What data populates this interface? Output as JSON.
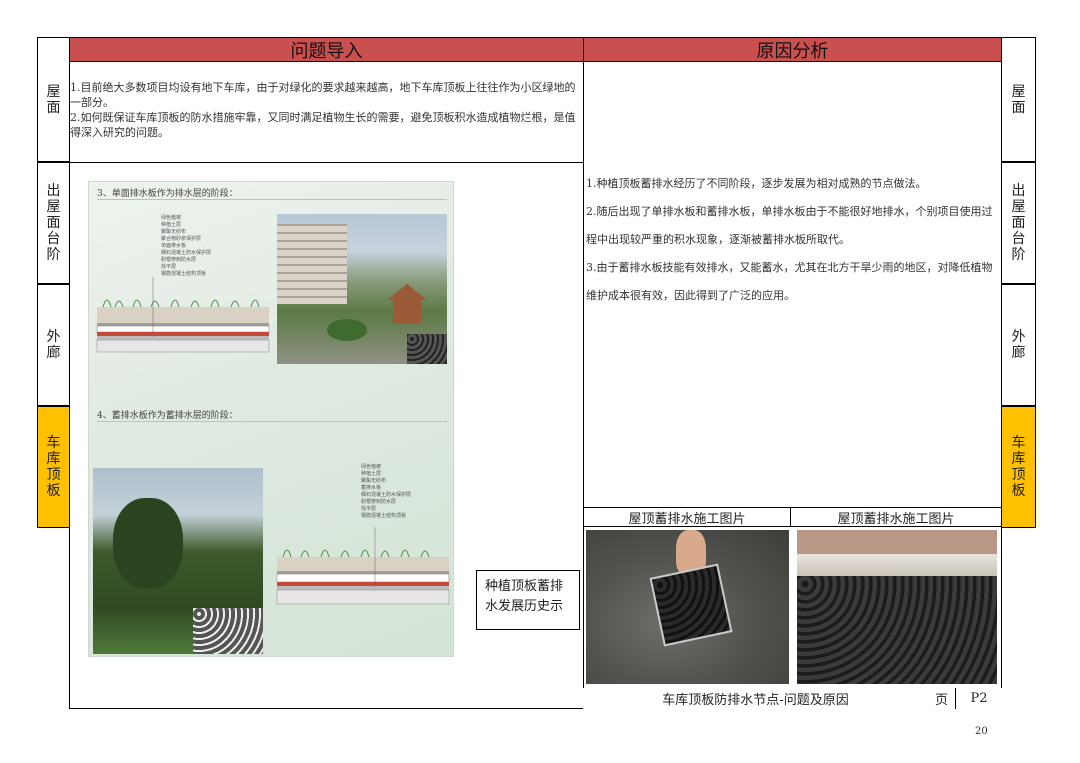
{
  "side_left": [
    {
      "label": "屋面",
      "active": false
    },
    {
      "label": "出屋面台阶",
      "active": false
    },
    {
      "label": "外廊",
      "active": false
    },
    {
      "label": "车库顶板",
      "active": true
    }
  ],
  "side_right": [
    {
      "label": "屋面",
      "active": false
    },
    {
      "label": "出屋面台阶",
      "active": false
    },
    {
      "label": "外廊",
      "active": false
    },
    {
      "label": "车库顶板",
      "active": true
    }
  ],
  "headers": {
    "problem": "问题导入",
    "cause": "原因分析"
  },
  "problem_text": [
    "1.目前绝大多数项目均设有地下车库，由于对绿化的要求越来越高，地下车库顶板上往往作为小区绿地的一部分。",
    "2.如何既保证车库顶板的防水措施牢靠，又同时满足植物生长的需要，避免顶板积水造成植物烂根，是值得深入研究的问题。"
  ],
  "cause_text": [
    "1.种植顶板蓄排水经历了不同阶段，逐步发展为相对成熟的节点做法。",
    "2.随后出现了单排水板和蓄排水板，单排水板由于不能很好地排水，个别项目使用过程中出现较严重的积水现象，逐渐被蓄排水板所取代。",
    "3.由于蓄排水板技能有效排水，又能蓄水，尤其在北方干旱少雨的地区，对降低植物维护成本很有效，因此得到了广泛的应用。"
  ],
  "doc_image": {
    "section3": "3、单面排水板作为排水层的阶段：",
    "section4": "4、蓄排水板作为蓄排水层的阶段：",
    "layers_top": [
      "绿色植被",
      "种植土层",
      "聚酯无纺布",
      "聚合物砂浆保护层",
      "单面排水板",
      "细石混凝土防水保护层",
      "耐根穿刺防水层",
      "找平层",
      "钢筋混凝土结构顶板"
    ],
    "layers_bottom": [
      "绿色植被",
      "种植土层",
      "聚酯无纺布",
      "蓄排水板",
      "细石混凝土防水保护层",
      "耐根穿刺防水层",
      "找平层",
      "钢筋混凝土结构顶板"
    ]
  },
  "doc_caption": "种植顶板蓄排水发展历史示",
  "photo_captions": [
    "屋顶蓄排水施工图片",
    "屋顶蓄排水施工图片"
  ],
  "footer": {
    "title": "车库顶板防排水节点-问题及原因",
    "page_label": "页",
    "page_value": "P2"
  },
  "page_number": "20"
}
